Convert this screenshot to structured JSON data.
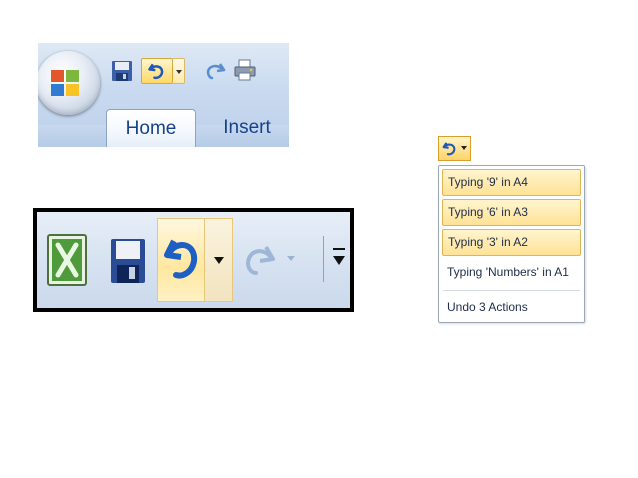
{
  "ribbon": {
    "tabs": [
      {
        "label": "Home",
        "active": true
      },
      {
        "label": "Insert",
        "active": false
      }
    ],
    "icons": [
      "office-button-icon",
      "save-icon",
      "undo-icon",
      "dropdown-icon",
      "redo-icon",
      "quick-print-icon"
    ]
  },
  "excel_qat": {
    "icons": [
      "excel-icon",
      "save-icon",
      "undo-icon",
      "dropdown-icon",
      "redo-icon",
      "redo-dropdown-icon",
      "customize-toolbar-icon"
    ]
  },
  "undo_list": {
    "items": [
      {
        "label": "Typing '9' in A4",
        "selected": true
      },
      {
        "label": "Typing '6' in A3",
        "selected": true
      },
      {
        "label": "Typing '3' in A2",
        "selected": true
      },
      {
        "label": "Typing 'Numbers' in A1",
        "selected": false
      }
    ],
    "footer": "Undo 3 Actions"
  },
  "colors": {
    "ribbon_bg": "#c9daf0",
    "tab_text": "#15428b",
    "highlight": "#ffd865",
    "highlight_border": "#d9a838"
  }
}
